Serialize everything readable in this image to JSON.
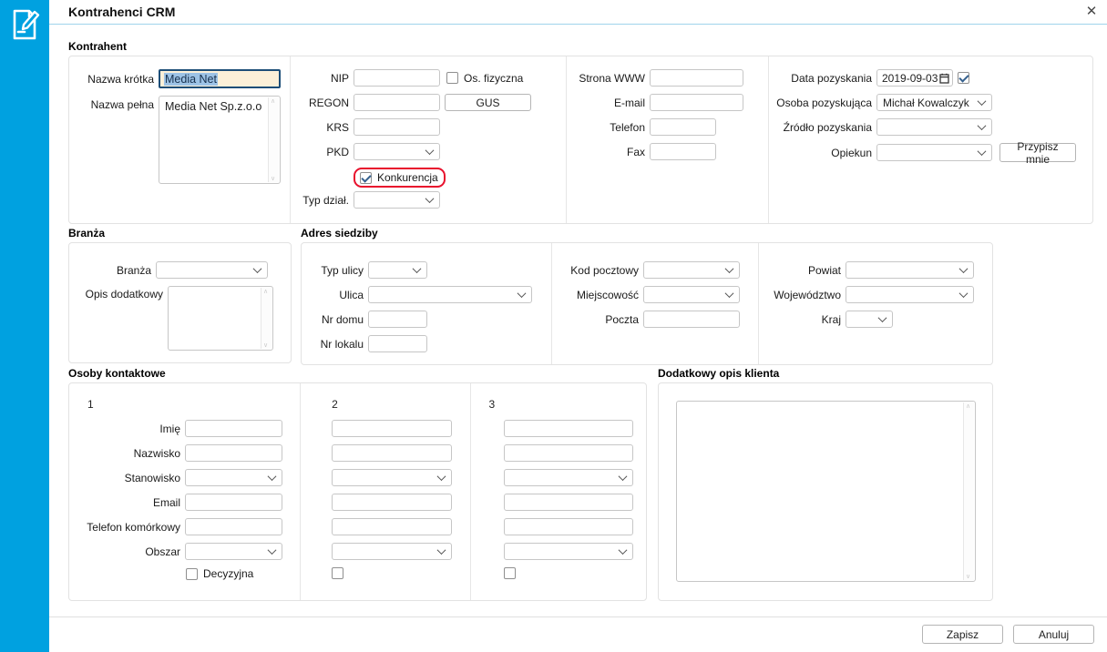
{
  "app": {
    "title": "Kontrahenci CRM",
    "close_glyph": "✕"
  },
  "colors": {
    "sidebar": "#00a1e0",
    "header_underline": "#9fd4ec",
    "highlight_outline": "#e8112d",
    "focus_border": "#1d4e78",
    "focus_bg": "#fbf0d8",
    "selection_bg": "#9dc3e6"
  },
  "kontrahent": {
    "section_title": "Kontrahent",
    "nazwa_krotka": {
      "label": "Nazwa krótka",
      "value": "Media Net"
    },
    "nazwa_pelna": {
      "label": "Nazwa pełna",
      "value": "Media Net Sp.z.o.o"
    },
    "nip": {
      "label": "NIP",
      "value": ""
    },
    "os_fizyczna": {
      "label": "Os. fizyczna",
      "checked": false
    },
    "regon": {
      "label": "REGON",
      "value": ""
    },
    "gus_button": "GUS",
    "krs": {
      "label": "KRS",
      "value": ""
    },
    "pkd": {
      "label": "PKD",
      "value": ""
    },
    "konkurencja": {
      "label": "Konkurencja",
      "checked": true
    },
    "typ_dzial": {
      "label": "Typ dział.",
      "value": ""
    },
    "strona_www": {
      "label": "Strona WWW",
      "value": ""
    },
    "email": {
      "label": "E-mail",
      "value": ""
    },
    "telefon": {
      "label": "Telefon",
      "value": ""
    },
    "fax": {
      "label": "Fax",
      "value": ""
    },
    "data_pozyskania": {
      "label": "Data pozyskania",
      "value": "2019-09-03",
      "checked": true
    },
    "osoba_pozyskujaca": {
      "label": "Osoba pozyskująca",
      "value": "Michał Kowalczyk"
    },
    "zrodlo_pozyskania": {
      "label": "Źródło pozyskania",
      "value": ""
    },
    "opiekun": {
      "label": "Opiekun",
      "value": ""
    },
    "przypisz_button": "Przypisz mnie"
  },
  "branza": {
    "section_title": "Branża",
    "branza": {
      "label": "Branża",
      "value": ""
    },
    "opis_dodatkowy": {
      "label": "Opis dodatkowy",
      "value": ""
    }
  },
  "adres": {
    "section_title": "Adres siedziby",
    "typ_ulicy": {
      "label": "Typ ulicy",
      "value": ""
    },
    "ulica": {
      "label": "Ulica",
      "value": ""
    },
    "nr_domu": {
      "label": "Nr domu",
      "value": ""
    },
    "nr_lokalu": {
      "label": "Nr lokalu",
      "value": ""
    },
    "kod_pocztowy": {
      "label": "Kod pocztowy",
      "value": ""
    },
    "miejscowosc": {
      "label": "Miejscowość",
      "value": ""
    },
    "poczta": {
      "label": "Poczta",
      "value": ""
    },
    "powiat": {
      "label": "Powiat",
      "value": ""
    },
    "wojewodztwo": {
      "label": "Województwo",
      "value": ""
    },
    "kraj": {
      "label": "Kraj",
      "value": ""
    }
  },
  "osoby": {
    "section_title": "Osoby kontaktowe",
    "columns": [
      "1",
      "2",
      "3"
    ],
    "field_labels": [
      "Imię",
      "Nazwisko",
      "Stanowisko",
      "Email",
      "Telefon komórkowy",
      "Obszar"
    ],
    "decyzyjna": {
      "label": "Decyzyjna",
      "checked_1": false,
      "checked_2": false,
      "checked_3": false
    }
  },
  "dodatkowy_opis": {
    "section_title": "Dodatkowy opis klienta",
    "value": ""
  },
  "footer": {
    "save_label": "Zapisz",
    "cancel_label": "Anuluj"
  }
}
